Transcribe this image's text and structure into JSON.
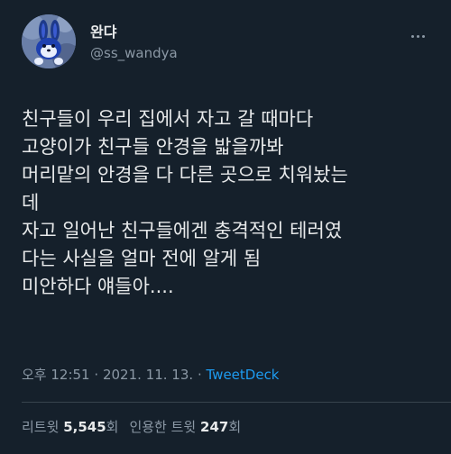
{
  "user": {
    "display_name": "완댜",
    "handle": "@ss_wandya",
    "avatar_icon": "blue-bunny-avatar-icon"
  },
  "menu": {
    "more_icon": "more-dots-icon"
  },
  "tweet": {
    "lines": [
      "친구들이 우리 집에서 자고 갈 때마다",
      "고양이가 친구들 안경을 밟을까봐",
      "머리맡의 안경을 다 다른 곳으로 치워놨는",
      "데",
      "자고 일어난 친구들에겐 충격적인 테러였",
      "다는 사실을 얼마 전에 알게 됨",
      "미안하다 얘들아...."
    ],
    "time": "오후 12:51",
    "separator": "·",
    "date": "2021. 11. 13.",
    "source": "TweetDeck"
  },
  "stats": {
    "retweets_label": "리트윗",
    "retweets_count": "5,545",
    "retweets_unit": "회",
    "quotes_label": "인용한 트윗",
    "quotes_count": "247",
    "quotes_unit": "회"
  },
  "colors": {
    "background": "#15202b",
    "text_primary": "#e7e9ea",
    "text_secondary": "#8b98a5",
    "link": "#1d9bf0",
    "divider": "#38444d"
  }
}
